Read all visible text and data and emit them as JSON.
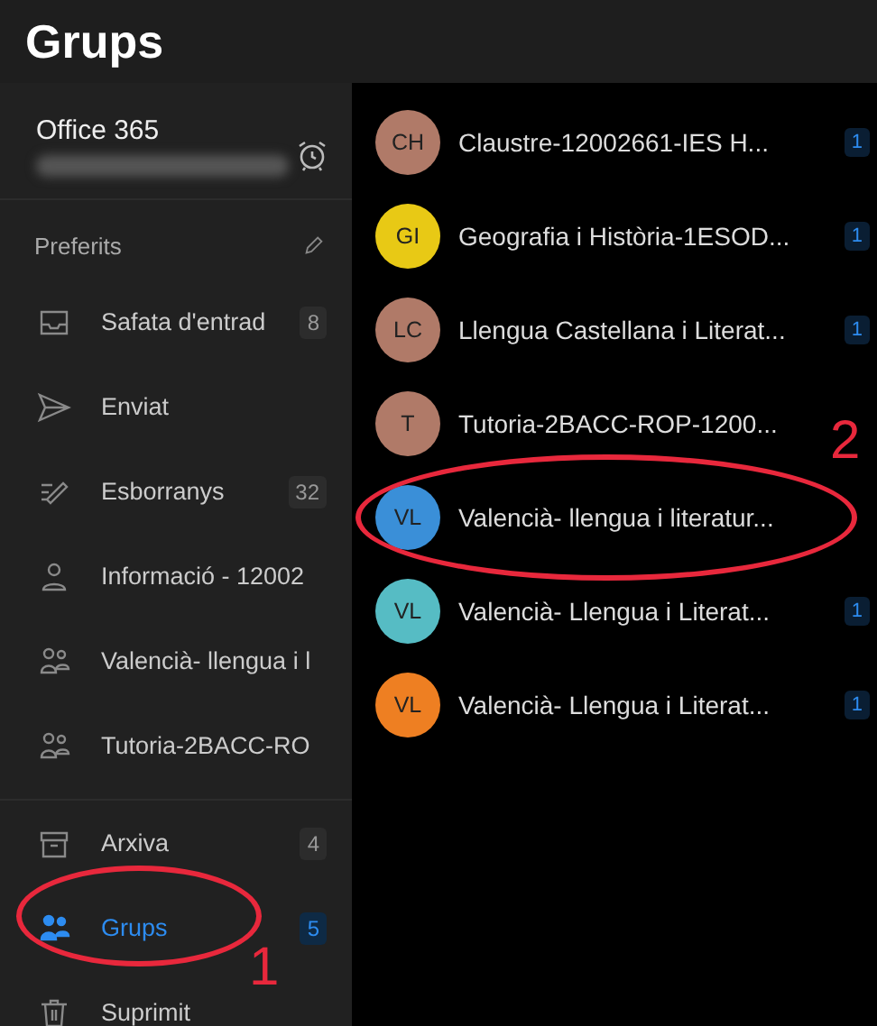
{
  "header": {
    "title": "Grups"
  },
  "account": {
    "name": "Office 365"
  },
  "favorites": {
    "title": "Preferits"
  },
  "folders": [
    {
      "label": "Safata d'entrad",
      "count": "8",
      "kind": "inbox",
      "selected": false
    },
    {
      "label": "Enviat",
      "kind": "sent",
      "selected": false
    },
    {
      "label": "Esborranys",
      "count": "32",
      "kind": "drafts",
      "selected": false
    },
    {
      "label": "Informació - 12002",
      "kind": "person",
      "selected": false
    },
    {
      "label": "Valencià- llengua i l",
      "kind": "group",
      "selected": false
    },
    {
      "label": "Tutoria-2BACC-RO",
      "kind": "group",
      "selected": false
    },
    {
      "label": "Arxiva",
      "count": "4",
      "kind": "archive",
      "selected": false,
      "divider_before": true
    },
    {
      "label": "Grups",
      "count": "5",
      "kind": "groups",
      "selected": true
    },
    {
      "label": "Suprimit",
      "kind": "trash",
      "selected": false
    }
  ],
  "groups": [
    {
      "initials": "CH",
      "name": "Claustre-12002661-IES H...",
      "color": "#b07a68",
      "unread": "1"
    },
    {
      "initials": "GI",
      "name": "Geografia i Història-1ESOD...",
      "color": "#e8c915",
      "unread": "1"
    },
    {
      "initials": "LC",
      "name": "Llengua Castellana i Literat...",
      "color": "#b07a68",
      "unread": "1"
    },
    {
      "initials": "T",
      "name": "Tutoria-2BACC-ROP-1200...",
      "color": "#b07a68"
    },
    {
      "initials": "VL",
      "name": "Valencià- llengua i literatur...",
      "color": "#3a8fd8"
    },
    {
      "initials": "VL",
      "name": "Valencià- Llengua i Literat...",
      "color": "#56bcc4",
      "unread": "1"
    },
    {
      "initials": "VL",
      "name": "Valencià- Llengua i Literat...",
      "color": "#ee7f22",
      "unread": "1"
    }
  ],
  "annotations": [
    "1",
    "2"
  ]
}
